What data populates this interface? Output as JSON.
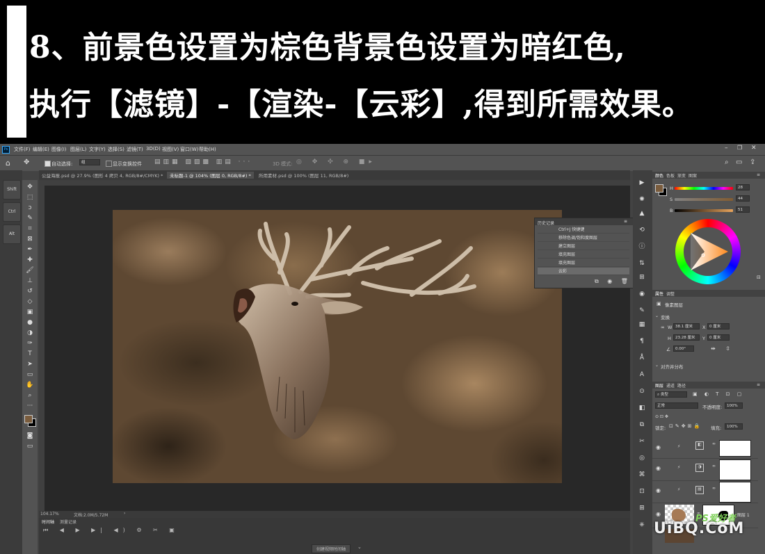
{
  "banner": {
    "line1": "8、前景色设置为棕色背景色设置为暗红色,",
    "line2": "执行【滤镜】-【渲染-【云彩】,得到所需效果。"
  },
  "menu": [
    "文件(F)",
    "编辑(E)",
    "图像(I)",
    "图层(L)",
    "文字(Y)",
    "选择(S)",
    "滤镜(T)",
    "3D(D)",
    "视图(V)",
    "窗口(W)",
    "帮助(H)"
  ],
  "options": {
    "auto_select_label": "自动选择:",
    "auto_select_value": "组",
    "show_transform": "显示变换控件",
    "mode_3d": "3D 模式:"
  },
  "tabs": [
    "公益海报.psd @ 27.9% (图形 4 拷贝 4, RGB/8#/CMYK) *",
    "未标题-1 @ 104% (图层 0, RGB/8#) *",
    "所用素材.psd @ 100% (图层 11, RGB/8#)"
  ],
  "left_keys": [
    "Shift",
    "Ctrl",
    "Alt"
  ],
  "status": {
    "zoom": "104.17%",
    "doc": "文档:2.0M/5.72M"
  },
  "timeline": {
    "tab1": "时间轴",
    "tab2": "测量记录",
    "create_btn": "创建视频时间轴"
  },
  "history": {
    "title": "历史记录",
    "items": [
      "Ctrl+J 快捷键",
      "移除色调/饱和度图层",
      "建立图层",
      "填充图层",
      "填充图层",
      "云彩"
    ]
  },
  "color_panel": {
    "tabs": [
      "颜色",
      "色板",
      "渐变",
      "图案"
    ],
    "h_label": "H",
    "h_value": "28",
    "s_label": "S",
    "s_value": "44",
    "b_label": "B",
    "b_value": "51"
  },
  "props_panel": {
    "tabs": [
      "属性",
      "调整"
    ],
    "doc_label": "像素图层",
    "transform": "变换",
    "w_label": "W",
    "w_value": "38.1 厘米",
    "h_label": "H",
    "h_value": "23.28 厘米",
    "x_label": "X",
    "x_value": "0 厘米",
    "y_label": "Y",
    "y_value": "0 厘米",
    "angle": "0.00°",
    "align": "对齐并分布"
  },
  "layers_panel": {
    "tabs": [
      "图层",
      "通道",
      "路径"
    ],
    "kind": "类型",
    "blend": "正常",
    "opacity_label": "不透明度:",
    "opacity": "100%",
    "lock_label": "锁定:",
    "fill_label": "填充:",
    "fill": "100%",
    "layer5_name": "图层 1"
  },
  "watermark": {
    "main": "UiBQ.CoM",
    "sub": "PS爱好者"
  },
  "colors": {
    "foreground": "#7a5c3d",
    "background": "#000000",
    "accent": "#31a8ff"
  }
}
